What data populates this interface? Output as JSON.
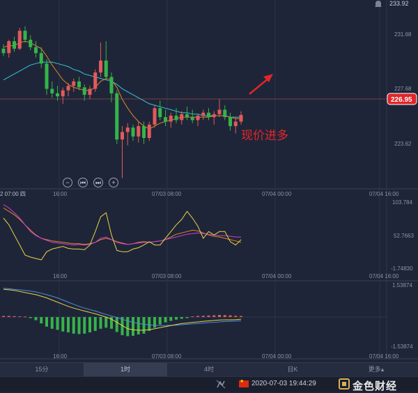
{
  "price_axis": {
    "top_value": "233.92",
    "ticks": [
      "231.68",
      "227.68",
      "223.62"
    ],
    "current_price": "226.95"
  },
  "annotation": "现价进多",
  "time_axis_main": {
    "left_cut": "2 07:00 四",
    "labels": [
      "16:00",
      "07/03 08:00",
      "07/04 00:00",
      "07/04 16:00"
    ]
  },
  "indicator1": {
    "top": "103.784",
    "mid": "52.7663",
    "bottom": "-1.74830"
  },
  "time_axis_ind1": [
    "16:00",
    "07/03 08:00",
    "07/04 00:00",
    "07/04 16:00"
  ],
  "indicator2": {
    "top": "1.53874",
    "bottom": "-1.53874"
  },
  "time_axis_ind2": [
    "16:00",
    "07/03 08:00",
    "07/04 00:00",
    "07/04 16:00"
  ],
  "controls": [
    "−",
    "⏮",
    "⏭",
    "+"
  ],
  "tabs": [
    {
      "label": "15分",
      "active": false
    },
    {
      "label": "1时",
      "active": true
    },
    {
      "label": "4时",
      "active": false
    },
    {
      "label": "日K",
      "active": false
    },
    {
      "label": "更多▴",
      "active": false
    }
  ],
  "status": {
    "timestamp": "2020-07-03 19:44:29",
    "logo_text": "金色财经"
  },
  "colors": {
    "up": "#e25a5a",
    "down": "#36b34a",
    "ma_fast": "#e0882a",
    "ma_slow": "#33c7d8",
    "kdj_j": "#e8d544",
    "kdj_d": "#d040d0",
    "macd_dif": "#e8d544",
    "macd_dea": "#4d8fe0",
    "accent_red": "#e0262a"
  },
  "chart_data": [
    {
      "type": "candlestick",
      "title": "",
      "y_range": [
        222.5,
        234.2
      ],
      "current_price": 226.95,
      "candles": [
        [
          231.4,
          231.7,
          230.9,
          231.1
        ],
        [
          231.1,
          232.0,
          230.8,
          231.9
        ],
        [
          231.9,
          232.2,
          231.2,
          231.4
        ],
        [
          231.4,
          232.8,
          231.3,
          232.6
        ],
        [
          232.6,
          232.9,
          231.8,
          232.0
        ],
        [
          232.0,
          232.3,
          231.3,
          231.5
        ],
        [
          231.5,
          231.9,
          230.8,
          231.1
        ],
        [
          231.1,
          231.5,
          230.1,
          230.4
        ],
        [
          230.4,
          230.7,
          228.3,
          228.7
        ],
        [
          228.7,
          229.2,
          228.1,
          228.4
        ],
        [
          228.4,
          228.9,
          227.9,
          228.2
        ],
        [
          228.2,
          228.8,
          227.7,
          228.6
        ],
        [
          228.6,
          229.1,
          228.2,
          228.9
        ],
        [
          228.9,
          229.4,
          228.5,
          229.2
        ],
        [
          229.2,
          229.5,
          228.6,
          228.8
        ],
        [
          228.8,
          229.0,
          227.9,
          228.3
        ],
        [
          228.3,
          228.9,
          228.0,
          228.7
        ],
        [
          228.7,
          230.0,
          228.5,
          229.8
        ],
        [
          229.8,
          231.8,
          229.5,
          230.6
        ],
        [
          230.6,
          231.9,
          229.3,
          229.5
        ],
        [
          229.5,
          229.8,
          227.8,
          228.4
        ],
        [
          228.4,
          228.6,
          225.0,
          225.3
        ],
        [
          225.3,
          226.2,
          222.7,
          225.8
        ],
        [
          225.8,
          226.4,
          224.9,
          226.1
        ],
        [
          226.1,
          226.3,
          225.2,
          225.5
        ],
        [
          225.5,
          226.5,
          225.1,
          226.2
        ],
        [
          226.2,
          226.5,
          225.0,
          225.4
        ],
        [
          225.4,
          226.5,
          225.2,
          226.3
        ],
        [
          226.3,
          227.6,
          226.1,
          227.4
        ],
        [
          227.4,
          227.9,
          226.6,
          226.8
        ],
        [
          226.8,
          227.3,
          226.2,
          226.5
        ],
        [
          226.5,
          227.1,
          226.1,
          226.9
        ],
        [
          226.9,
          227.4,
          226.4,
          226.6
        ],
        [
          226.6,
          227.2,
          226.3,
          227.0
        ],
        [
          227.0,
          227.5,
          226.6,
          226.8
        ],
        [
          226.8,
          227.3,
          226.4,
          226.6
        ],
        [
          226.6,
          227.0,
          226.2,
          226.9
        ],
        [
          226.9,
          227.3,
          226.6,
          227.1
        ],
        [
          227.1,
          227.4,
          226.6,
          226.8
        ],
        [
          226.8,
          227.2,
          226.3,
          227.0
        ],
        [
          227.0,
          228.0,
          226.8,
          227.3
        ],
        [
          227.3,
          227.6,
          226.6,
          226.8
        ],
        [
          226.8,
          227.1,
          225.9,
          226.2
        ],
        [
          226.2,
          226.8,
          225.7,
          226.5
        ],
        [
          226.5,
          227.2,
          226.3,
          226.95
        ]
      ],
      "ma_fast": [
        231.5,
        231.6,
        231.6,
        231.8,
        231.9,
        231.8,
        231.6,
        231.4,
        230.9,
        230.3,
        229.8,
        229.3,
        229.0,
        228.8,
        228.7,
        228.6,
        228.6,
        228.8,
        229.2,
        229.4,
        229.3,
        228.8,
        228.0,
        227.4,
        226.9,
        226.5,
        226.2,
        226.0,
        226.2,
        226.4,
        226.5,
        226.6,
        226.7,
        226.8,
        226.8,
        226.8,
        226.8,
        226.8,
        226.8,
        226.9,
        226.9,
        226.9,
        226.8,
        226.7,
        226.7
      ],
      "ma_slow": [
        229.3,
        229.5,
        229.7,
        229.9,
        230.1,
        230.3,
        230.4,
        230.5,
        230.5,
        230.5,
        230.4,
        230.3,
        230.2,
        230.0,
        229.9,
        229.7,
        229.6,
        229.5,
        229.4,
        229.3,
        229.2,
        229.0,
        228.7,
        228.5,
        228.3,
        228.1,
        227.9,
        227.7,
        227.6,
        227.5,
        227.4,
        227.3,
        227.2,
        227.1,
        227.1,
        227.0,
        227.0,
        226.9,
        226.9,
        226.9,
        226.9,
        226.9,
        226.8,
        226.8,
        226.8
      ]
    },
    {
      "type": "line",
      "title": "",
      "y_range": [
        -1.7483,
        103.784
      ],
      "series": [
        {
          "values": [
            95,
            90,
            85,
            78,
            70,
            62,
            55,
            50,
            48,
            46,
            45,
            44,
            43,
            42,
            42,
            41,
            42,
            44,
            48,
            50,
            48,
            45,
            43,
            41,
            42,
            44,
            45,
            44,
            45,
            46,
            48,
            52,
            56,
            58,
            60,
            62,
            61,
            58,
            55,
            53,
            52,
            50,
            48,
            46,
            44
          ]
        },
        {
          "values": [
            100,
            95,
            88,
            80,
            70,
            60,
            54,
            50,
            47,
            44,
            43,
            42,
            41,
            40,
            41,
            40,
            41,
            44,
            50,
            52,
            48,
            44,
            42,
            41,
            42,
            43,
            44,
            44,
            45,
            46,
            48,
            50,
            52,
            54,
            56,
            57,
            58,
            57,
            56,
            55,
            54,
            54,
            53,
            52,
            52
          ]
        },
        {
          "values": [
            80,
            70,
            55,
            40,
            25,
            22,
            20,
            18,
            30,
            34,
            36,
            38,
            35,
            34,
            34,
            33,
            40,
            60,
            82,
            88,
            55,
            32,
            30,
            30,
            34,
            36,
            40,
            45,
            40,
            40,
            50,
            60,
            70,
            78,
            90,
            80,
            68,
            50,
            60,
            55,
            60,
            60,
            45,
            40,
            48
          ]
        }
      ]
    },
    {
      "type": "bar+line",
      "title": "",
      "y_range": [
        -1.53874,
        1.53874
      ],
      "histogram": [
        0.05,
        0.05,
        0.04,
        0.03,
        0.02,
        -0.05,
        -0.15,
        -0.3,
        -0.45,
        -0.55,
        -0.6,
        -0.68,
        -0.72,
        -0.78,
        -0.8,
        -0.78,
        -0.72,
        -0.65,
        -0.55,
        -0.5,
        -0.55,
        -0.7,
        -0.85,
        -0.9,
        -0.88,
        -0.82,
        -0.78,
        -0.65,
        -0.5,
        -0.35,
        -0.25,
        -0.18,
        -0.12,
        -0.08,
        -0.05,
        0.03,
        0.05,
        0.06,
        0.07,
        0.08,
        0.1,
        0.09,
        0.08,
        0.06,
        0.05
      ],
      "dif": [
        1.3,
        1.28,
        1.25,
        1.2,
        1.15,
        1.1,
        1.05,
        0.98,
        0.9,
        0.8,
        0.7,
        0.6,
        0.5,
        0.42,
        0.35,
        0.28,
        0.22,
        0.15,
        0.08,
        0.0,
        -0.1,
        -0.25,
        -0.4,
        -0.55,
        -0.6,
        -0.62,
        -0.62,
        -0.6,
        -0.55,
        -0.5,
        -0.45,
        -0.4,
        -0.35,
        -0.3,
        -0.28,
        -0.25,
        -0.23,
        -0.2,
        -0.18,
        -0.16,
        -0.14,
        -0.13,
        -0.13,
        -0.12,
        -0.1
      ],
      "dea": [
        1.35,
        1.33,
        1.3,
        1.28,
        1.25,
        1.22,
        1.18,
        1.12,
        1.05,
        0.98,
        0.9,
        0.8,
        0.7,
        0.6,
        0.5,
        0.42,
        0.35,
        0.28,
        0.2,
        0.12,
        0.05,
        -0.02,
        -0.1,
        -0.18,
        -0.25,
        -0.3,
        -0.34,
        -0.37,
        -0.39,
        -0.4,
        -0.4,
        -0.39,
        -0.38,
        -0.36,
        -0.34,
        -0.32,
        -0.3,
        -0.28,
        -0.26,
        -0.25,
        -0.23,
        -0.21,
        -0.2,
        -0.19,
        -0.18
      ]
    }
  ]
}
